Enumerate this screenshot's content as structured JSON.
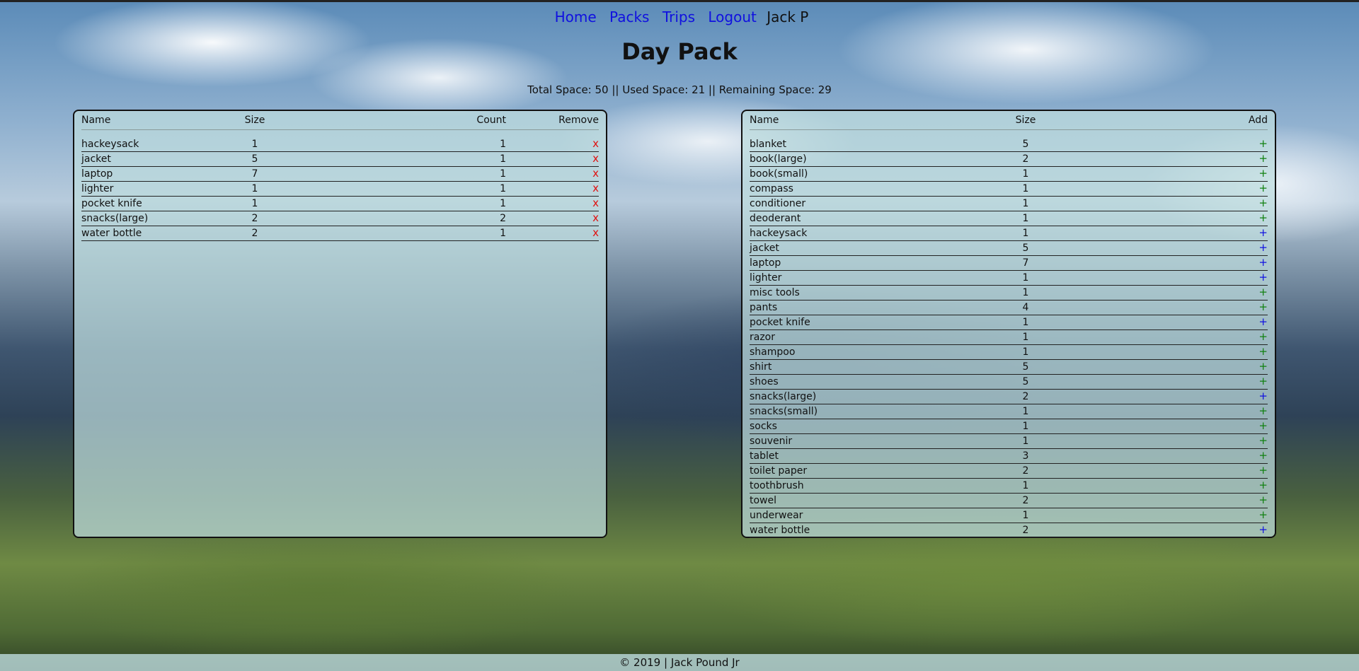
{
  "nav": {
    "home": "Home",
    "packs": "Packs",
    "trips": "Trips",
    "logout": "Logout",
    "user": "Jack P"
  },
  "page": {
    "title": "Day Pack",
    "summary": "Total Space: 50 || Used Space: 21 || Remaining Space: 29"
  },
  "pack_table": {
    "headers": {
      "name": "Name",
      "size": "Size",
      "count": "Count",
      "remove": "Remove"
    },
    "remove_glyph": "x",
    "rows": [
      {
        "name": "hackeysack",
        "size": "1",
        "count": "1"
      },
      {
        "name": "jacket",
        "size": "5",
        "count": "1"
      },
      {
        "name": "laptop",
        "size": "7",
        "count": "1"
      },
      {
        "name": "lighter",
        "size": "1",
        "count": "1"
      },
      {
        "name": "pocket knife",
        "size": "1",
        "count": "1"
      },
      {
        "name": "snacks(large)",
        "size": "2",
        "count": "2"
      },
      {
        "name": "water bottle",
        "size": "2",
        "count": "1"
      }
    ]
  },
  "items_table": {
    "headers": {
      "name": "Name",
      "size": "Size",
      "add": "Add"
    },
    "add_glyph": "+",
    "colors": {
      "in_pack": "#1010e0",
      "not_in_pack": "#108010"
    },
    "rows": [
      {
        "name": "blanket",
        "size": "5",
        "in_pack": false
      },
      {
        "name": "book(large)",
        "size": "2",
        "in_pack": false
      },
      {
        "name": "book(small)",
        "size": "1",
        "in_pack": false
      },
      {
        "name": "compass",
        "size": "1",
        "in_pack": false
      },
      {
        "name": "conditioner",
        "size": "1",
        "in_pack": false
      },
      {
        "name": "deoderant",
        "size": "1",
        "in_pack": false
      },
      {
        "name": "hackeysack",
        "size": "1",
        "in_pack": true
      },
      {
        "name": "jacket",
        "size": "5",
        "in_pack": true
      },
      {
        "name": "laptop",
        "size": "7",
        "in_pack": true
      },
      {
        "name": "lighter",
        "size": "1",
        "in_pack": true
      },
      {
        "name": "misc tools",
        "size": "1",
        "in_pack": false
      },
      {
        "name": "pants",
        "size": "4",
        "in_pack": false
      },
      {
        "name": "pocket knife",
        "size": "1",
        "in_pack": true
      },
      {
        "name": "razor",
        "size": "1",
        "in_pack": false
      },
      {
        "name": "shampoo",
        "size": "1",
        "in_pack": false
      },
      {
        "name": "shirt",
        "size": "5",
        "in_pack": false
      },
      {
        "name": "shoes",
        "size": "5",
        "in_pack": false
      },
      {
        "name": "snacks(large)",
        "size": "2",
        "in_pack": true
      },
      {
        "name": "snacks(small)",
        "size": "1",
        "in_pack": false
      },
      {
        "name": "socks",
        "size": "1",
        "in_pack": false
      },
      {
        "name": "souvenir",
        "size": "1",
        "in_pack": false
      },
      {
        "name": "tablet",
        "size": "3",
        "in_pack": false
      },
      {
        "name": "toilet paper",
        "size": "2",
        "in_pack": false
      },
      {
        "name": "toothbrush",
        "size": "1",
        "in_pack": false
      },
      {
        "name": "towel",
        "size": "2",
        "in_pack": false
      },
      {
        "name": "underwear",
        "size": "1",
        "in_pack": false
      },
      {
        "name": "water bottle",
        "size": "2",
        "in_pack": true
      }
    ]
  },
  "footer": {
    "text": "© 2019 | Jack Pound Jr"
  }
}
